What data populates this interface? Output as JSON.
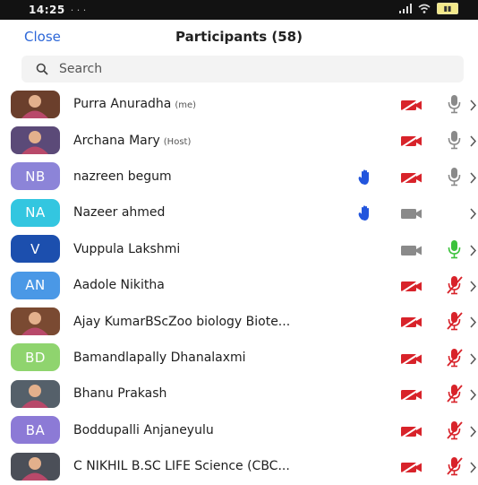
{
  "status_bar": {
    "time": "14:25",
    "dots": "· · ·"
  },
  "header": {
    "close_label": "Close",
    "title": "Participants (58)"
  },
  "search": {
    "placeholder": "Search"
  },
  "colors": {
    "accent": "#2d67d8",
    "video_off": "#d8232a",
    "mic_muted": "#d8232a",
    "mic_live": "#3cc23c",
    "icon_gray": "#8a8a8a",
    "hand": "#2255dd"
  },
  "participants": [
    {
      "name": "Purra Anuradha",
      "role": "(me)",
      "avatar_type": "photo",
      "initials": "",
      "avatar_color": "#6b3f2c",
      "hand_raised": false,
      "video": "off",
      "mic": "gray"
    },
    {
      "name": "Archana Mary",
      "role": "(Host)",
      "avatar_type": "photo",
      "initials": "",
      "avatar_color": "#5b4a78",
      "hand_raised": false,
      "video": "off",
      "mic": "gray"
    },
    {
      "name": "nazreen begum",
      "role": "",
      "avatar_type": "initials",
      "initials": "NB",
      "avatar_color": "#8c84d8",
      "hand_raised": true,
      "video": "off",
      "mic": "gray"
    },
    {
      "name": "Nazeer ahmed",
      "role": "",
      "avatar_type": "initials",
      "initials": "NA",
      "avatar_color": "#33c6e0",
      "hand_raised": true,
      "video": "gray",
      "mic": "none"
    },
    {
      "name": "Vuppula Lakshmi",
      "role": "",
      "avatar_type": "initials",
      "initials": "V",
      "avatar_color": "#1c4fae",
      "hand_raised": false,
      "video": "gray",
      "mic": "live"
    },
    {
      "name": "Aadole Nikitha",
      "role": "",
      "avatar_type": "initials",
      "initials": "AN",
      "avatar_color": "#4a98e6",
      "hand_raised": false,
      "video": "off",
      "mic": "muted"
    },
    {
      "name": "Ajay KumarBScZoo biology Biote...",
      "role": "",
      "avatar_type": "photo",
      "initials": "",
      "avatar_color": "#7a4a32",
      "hand_raised": false,
      "video": "off",
      "mic": "muted"
    },
    {
      "name": "Bamandlapally Dhanalaxmi",
      "role": "",
      "avatar_type": "initials",
      "initials": "BD",
      "avatar_color": "#8fd46e",
      "hand_raised": false,
      "video": "off",
      "mic": "muted"
    },
    {
      "name": "Bhanu Prakash",
      "role": "",
      "avatar_type": "photo",
      "initials": "",
      "avatar_color": "#55606a",
      "hand_raised": false,
      "video": "off",
      "mic": "muted"
    },
    {
      "name": "Boddupalli Anjaneyulu",
      "role": "",
      "avatar_type": "initials",
      "initials": "BA",
      "avatar_color": "#8c7ad6",
      "hand_raised": false,
      "video": "off",
      "mic": "muted"
    },
    {
      "name": "C NIKHIL B.SC LIFE Science (CBC...",
      "role": "",
      "avatar_type": "photo",
      "initials": "",
      "avatar_color": "#4b4f58",
      "hand_raised": false,
      "video": "off",
      "mic": "muted"
    }
  ]
}
